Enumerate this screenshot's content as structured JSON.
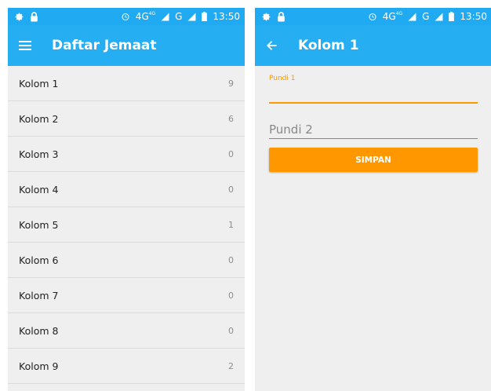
{
  "status_bar": {
    "network": "4G",
    "network_superscript": "4G",
    "network2": "G",
    "time": "13:50"
  },
  "list_screen": {
    "title": "Daftar Jemaat",
    "items": [
      {
        "label": "Kolom 1",
        "count": "9"
      },
      {
        "label": "Kolom 2",
        "count": "6"
      },
      {
        "label": "Kolom 3",
        "count": "0"
      },
      {
        "label": "Kolom 4",
        "count": "0"
      },
      {
        "label": "Kolom 5",
        "count": "1"
      },
      {
        "label": "Kolom 6",
        "count": "0"
      },
      {
        "label": "Kolom 7",
        "count": "0"
      },
      {
        "label": "Kolom 8",
        "count": "0"
      },
      {
        "label": "Kolom 9",
        "count": "2"
      }
    ]
  },
  "detail_screen": {
    "title": "Kolom 1",
    "pundi1_label": "Pundi 1",
    "pundi2_placeholder": "Pundi 2",
    "save_label": "SIMPAN"
  },
  "colors": {
    "primary": "#26aef3",
    "status_bar": "#1faaf1",
    "accent": "#ff9800"
  },
  "icons": [
    "gear-icon",
    "lock-icon",
    "alarm-icon",
    "signal-icon",
    "battery-icon",
    "menu-icon",
    "back-arrow-icon"
  ]
}
